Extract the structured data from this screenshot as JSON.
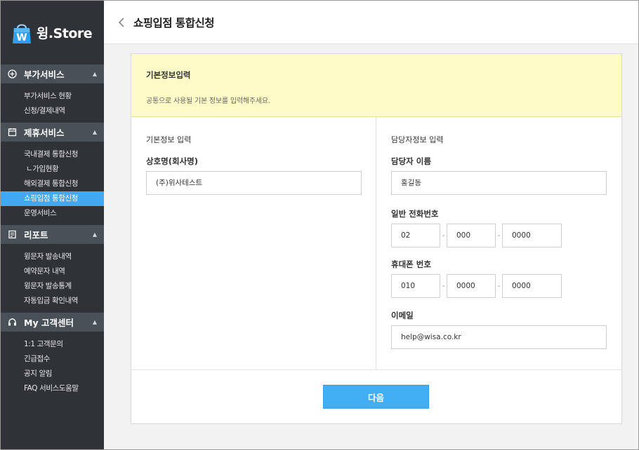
{
  "brand": {
    "logo_letter": "W",
    "name": "윙.Store",
    "accent": "#42a8f1"
  },
  "sidebar": {
    "sections": [
      {
        "icon": "plus-circle-icon",
        "title": "부가서비스",
        "items": [
          "부가서비스 현황",
          "신청/결제내역"
        ]
      },
      {
        "icon": "calendar-icon",
        "title": "제휴서비스",
        "items": [
          "국내결제 통합신청",
          "ㄴ가입현황",
          "해외결제 통합신청",
          "쇼핑입점 통합신청",
          "운영서비스"
        ]
      },
      {
        "icon": "document-icon",
        "title": "리포트",
        "items": [
          "윙문자 발송내역",
          "예약문자 내역",
          "윙문자 발송통계",
          "자동입금 확인내역"
        ]
      },
      {
        "icon": "headset-icon",
        "title": "My 고객센터",
        "items": [
          "1:1 고객문의",
          "긴급접수",
          "공지 알림",
          "FAQ 서비스도움말"
        ]
      }
    ]
  },
  "header": {
    "title": "쇼핑입점 통합신청"
  },
  "notice": {
    "title": "기본정보입력",
    "description": "공통으로 사용될 기본 정보를 입력해주세요."
  },
  "left": {
    "title": "기본정보 입력",
    "company_label": "상호명(회사명)",
    "company_value": "(주)위사테스트"
  },
  "right": {
    "title": "담당자정보 입력",
    "name_label": "담당자 이름",
    "name_value": "홍길동",
    "phone_label": "일반 전화번호",
    "phone": [
      "02",
      "000",
      "0000"
    ],
    "mobile_label": "휴대폰 번호",
    "mobile": [
      "010",
      "0000",
      "0000"
    ],
    "email_label": "이메일",
    "email_value": "help@wisa.co.kr",
    "dash": "-"
  },
  "actions": {
    "next_label": "다음"
  }
}
